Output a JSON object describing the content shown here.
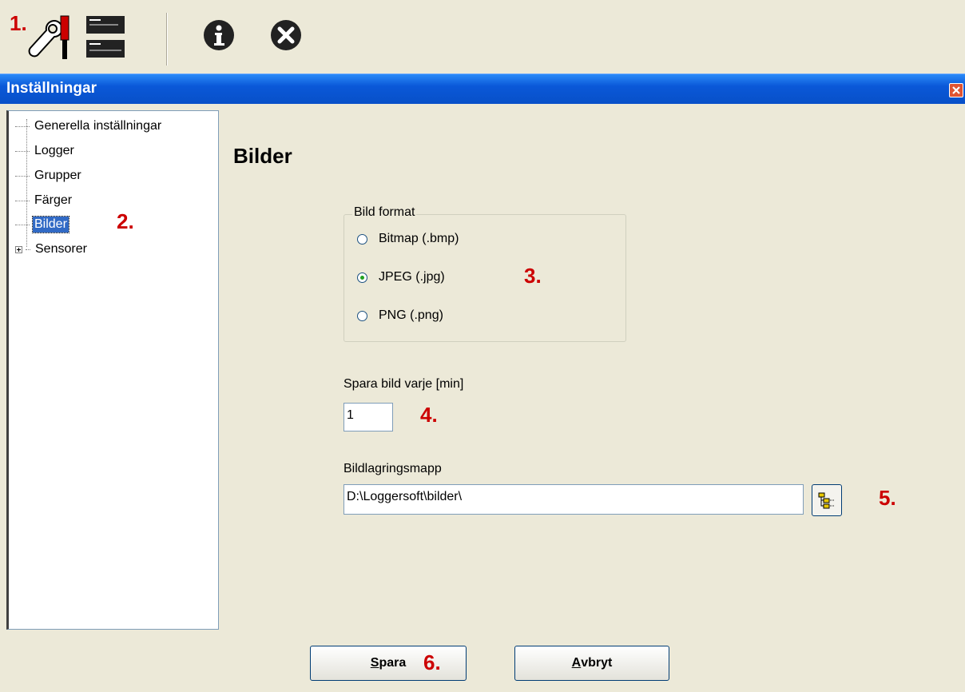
{
  "toolbar": {
    "icons": [
      "settings-tools-icon",
      "logger-devices-icon",
      "info-icon",
      "close-circle-icon"
    ],
    "marker": "1."
  },
  "window": {
    "title": "Inställningar"
  },
  "tree": {
    "items": [
      {
        "label": "Generella inställningar"
      },
      {
        "label": "Logger"
      },
      {
        "label": "Grupper"
      },
      {
        "label": "Färger"
      },
      {
        "label": "Bilder",
        "selected": true
      },
      {
        "label": "Sensorer",
        "expandable": true
      }
    ],
    "marker": "2."
  },
  "page": {
    "heading": "Bilder"
  },
  "image_format": {
    "legend": "Bild format",
    "options": [
      {
        "label": "Bitmap (.bmp)",
        "checked": false
      },
      {
        "label": "JPEG (.jpg)",
        "checked": true
      },
      {
        "label": "PNG (.png)",
        "checked": false
      }
    ],
    "marker": "3."
  },
  "interval": {
    "label": "Spara bild varje [min]",
    "value": "1",
    "marker": "4."
  },
  "folder": {
    "label": "Bildlagringsmapp",
    "value": "D:\\Loggersoft\\bilder\\",
    "marker": "5."
  },
  "buttons": {
    "save_accel": "S",
    "save_rest": "para",
    "save_marker": "6.",
    "cancel_accel": "A",
    "cancel_rest": "vbryt"
  },
  "colors": {
    "titlebar": "#0a58d8",
    "selection": "#316ac5",
    "marker": "#cc0000",
    "background": "#ece9d8"
  }
}
